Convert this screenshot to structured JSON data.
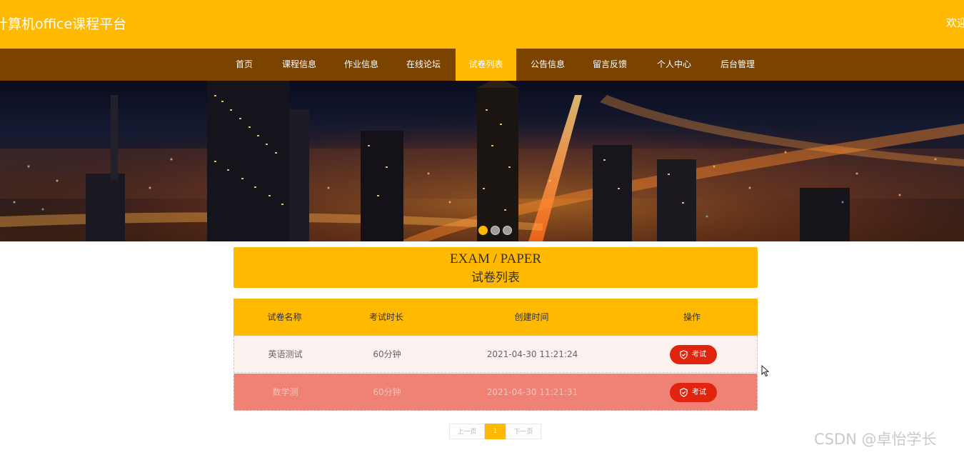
{
  "header": {
    "site_title": "计算机office课程平台",
    "welcome": "欢迎"
  },
  "nav": {
    "items": [
      "首页",
      "课程信息",
      "作业信息",
      "在线论坛",
      "试卷列表",
      "公告信息",
      "留言反馈",
      "个人中心",
      "后台管理"
    ],
    "active_index": 4
  },
  "carousel": {
    "dots": 3,
    "active_dot": 0
  },
  "section": {
    "title_en": "EXAM / PAPER",
    "title_cn": "试卷列表"
  },
  "table": {
    "columns": [
      "试卷名称",
      "考试时长",
      "创建时间",
      "操作"
    ],
    "rows": [
      {
        "name": "英语测试",
        "duration": "60分钟",
        "created": "2021-04-30 11:21:24",
        "action": "考试"
      },
      {
        "name": "数学测",
        "duration": "60分钟",
        "created": "2021-04-30 11:21:31",
        "action": "考试"
      }
    ]
  },
  "pagination": {
    "prev": "上一页",
    "current": "1",
    "next": "下一页"
  },
  "watermark": "CSDN @卓怡学长",
  "colors": {
    "accent": "#ffb900",
    "nav_bg": "#7a4300",
    "button": "#e0240e",
    "row_highlight": "#ef8275"
  },
  "icons": {
    "exam_button_icon": "shield-check-icon"
  }
}
